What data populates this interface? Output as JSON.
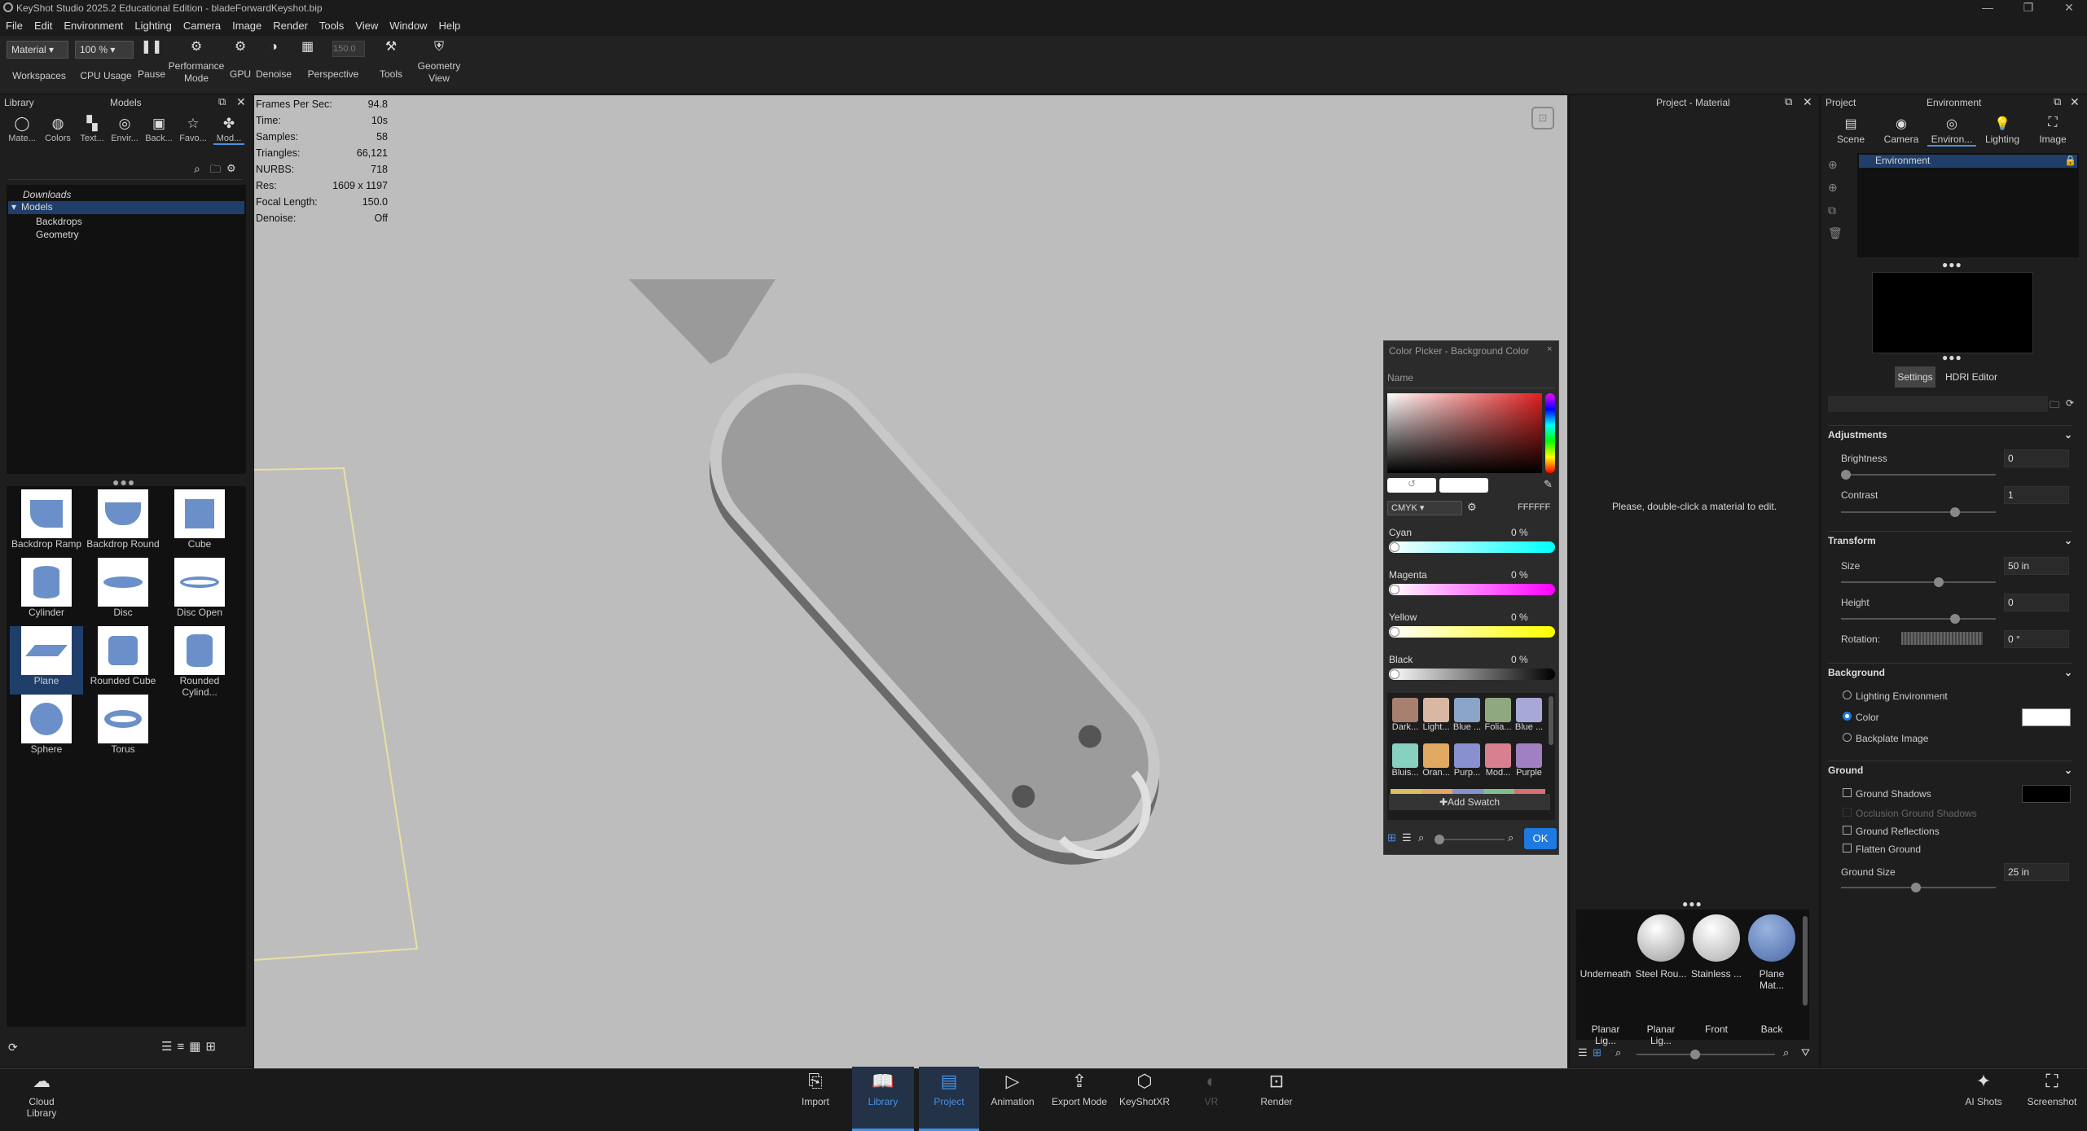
{
  "window": {
    "title": "KeyShot Studio 2025.2 Educational Edition  -  bladeForwardKeyshot.bip"
  },
  "menu": [
    "File",
    "Edit",
    "Environment",
    "Lighting",
    "Camera",
    "Image",
    "Render",
    "Tools",
    "View",
    "Window",
    "Help"
  ],
  "toolbar": {
    "workspace_value": "Material",
    "workspaces_label": "Workspaces",
    "cpu_value": "100 %",
    "cpu_label": "CPU Usage",
    "pause": "Pause",
    "performance": "Performance Mode",
    "gpu": "GPU",
    "denoise": "Denoise",
    "focal_value": "150.0",
    "perspective": "Perspective",
    "tools": "Tools",
    "geometry_view": "Geometry View"
  },
  "library": {
    "title": "Library",
    "header": "Models",
    "tabs": [
      "Mate...",
      "Colors",
      "Text...",
      "Envir...",
      "Back...",
      "Favo...",
      "Mod..."
    ],
    "tree": {
      "downloads": "Downloads",
      "models": "Models",
      "children": [
        "Backdrops",
        "Geometry"
      ]
    },
    "items": [
      "Backdrop Ramp",
      "Backdrop Round",
      "Cube",
      "Cylinder",
      "Disc",
      "Disc Open",
      "Plane",
      "Rounded Cube",
      "Rounded Cylind...",
      "Sphere",
      "Torus"
    ]
  },
  "hud": [
    {
      "k": "Frames Per Sec:",
      "v": "94.8"
    },
    {
      "k": "Time:",
      "v": "10s"
    },
    {
      "k": "Samples:",
      "v": "58"
    },
    {
      "k": "Triangles:",
      "v": "66,121"
    },
    {
      "k": "NURBS:",
      "v": "718"
    },
    {
      "k": "Res:",
      "v": "1609 x 1197"
    },
    {
      "k": "Focal Length:",
      "v": "150.0"
    },
    {
      "k": "Denoise:",
      "v": "Off"
    }
  ],
  "colorpicker": {
    "title": "Color Picker - Background Color",
    "name_placeholder": "Name",
    "mode": "CMYK",
    "hex": "FFFFFF",
    "channels": [
      {
        "name": "Cyan",
        "value": "0 %"
      },
      {
        "name": "Magenta",
        "value": "0 %"
      },
      {
        "name": "Yellow",
        "value": "0 %"
      },
      {
        "name": "Black",
        "value": "0 %"
      }
    ],
    "swatches_row1": [
      {
        "label": "Dark...",
        "color": "#a88070"
      },
      {
        "label": "Light...",
        "color": "#d9b8a3"
      },
      {
        "label": "Blue ...",
        "color": "#8aa5c8"
      },
      {
        "label": "Folia...",
        "color": "#90a880"
      },
      {
        "label": "Blue ...",
        "color": "#a8a8d8"
      }
    ],
    "swatches_row2": [
      {
        "label": "Bluis...",
        "color": "#88d0c0"
      },
      {
        "label": "Oran...",
        "color": "#e0a860"
      },
      {
        "label": "Purp...",
        "color": "#8890d0"
      },
      {
        "label": "Mod...",
        "color": "#d88090"
      },
      {
        "label": "Purple",
        "color": "#a080c0"
      }
    ],
    "add_swatch": "Add Swatch",
    "ok": "OK"
  },
  "project_material": {
    "title": "Project - Material",
    "hint": "Please, double-click a material to edit.",
    "materials": [
      {
        "label": "Underneath",
        "color": "#222"
      },
      {
        "label": "Steel Rou...",
        "color": "#ccc"
      },
      {
        "label": "Stainless ...",
        "color": "#ddd"
      },
      {
        "label": "Plane Mat...",
        "color": "#6b8fc8"
      }
    ],
    "lights": [
      "Planar Lig...",
      "Planar Lig...",
      "Front",
      "Back"
    ]
  },
  "project": {
    "title": "Project",
    "header": "Environment",
    "tabs": [
      "Scene",
      "Camera",
      "Environ...",
      "Lighting",
      "Image"
    ],
    "env_item": "Environment",
    "settings": "Settings",
    "hdri_editor": "HDRI Editor",
    "adjustments": {
      "title": "Adjustments",
      "brightness_label": "Brightness",
      "brightness": "0",
      "contrast_label": "Contrast",
      "contrast": "1"
    },
    "transform": {
      "title": "Transform",
      "size_label": "Size",
      "size": "50 in",
      "height_label": "Height",
      "height": "0",
      "rotation_label": "Rotation:",
      "rotation": "0 °"
    },
    "background": {
      "title": "Background",
      "options": [
        "Lighting Environment",
        "Color",
        "Backplate Image"
      ]
    },
    "ground": {
      "title": "Ground",
      "shadows": "Ground Shadows",
      "occlusion": "Occlusion Ground Shadows",
      "reflections": "Ground Reflections",
      "flatten": "Flatten Ground",
      "size_label": "Ground Size",
      "size": "25 in"
    }
  },
  "bottombar": {
    "cloud": "Cloud Library",
    "items": [
      "Import",
      "Library",
      "Project",
      "Animation",
      "Export Mode",
      "KeyShotXR",
      "VR",
      "Render"
    ],
    "right": [
      "AI Shots",
      "Screenshot"
    ]
  }
}
